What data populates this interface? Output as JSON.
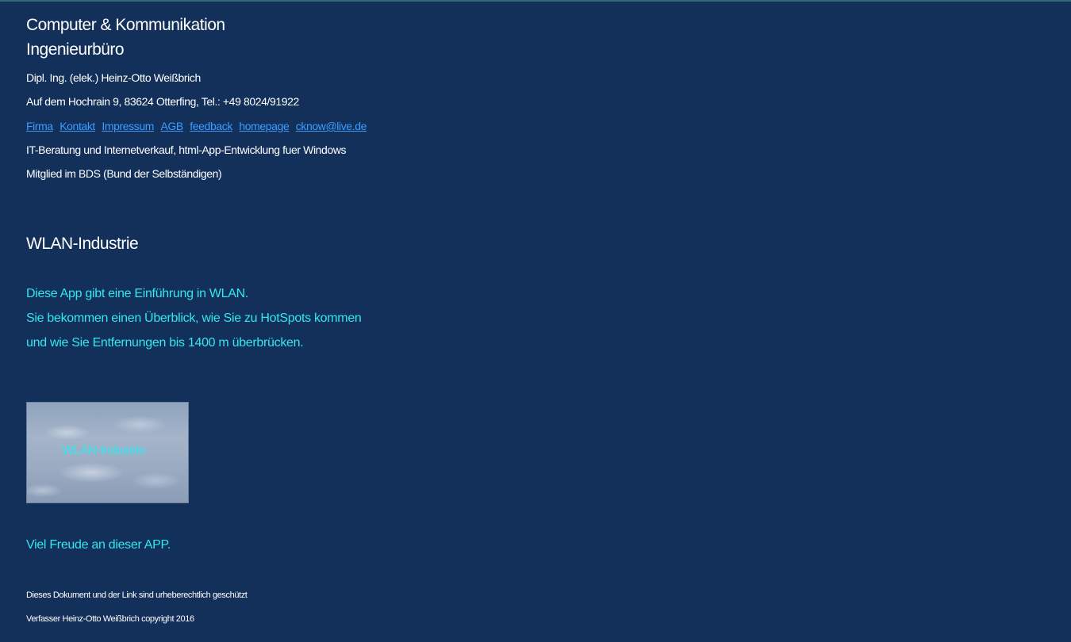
{
  "header": {
    "company_line1": "Computer & Kommunikation",
    "company_line2": "Ingenieurbüro",
    "owner": "Dipl. Ing. (elek.) Heinz-Otto Weißbrich",
    "address": "Auf dem Hochrain 9, 83624 Otterfing,   Tel.: +49 8024/91922",
    "nav_links": [
      {
        "label": "Firma"
      },
      {
        "label": "Kontakt"
      },
      {
        "label": "Impressum"
      },
      {
        "label": "AGB"
      },
      {
        "label": "feedback"
      },
      {
        "label": "homepage"
      },
      {
        "label": "cknow@live.de"
      }
    ],
    "services": "IT-Beratung und Internetverkauf, html-App-Entwicklung fuer Windows",
    "membership": "Mitglied im BDS (Bund der Selbständigen)"
  },
  "main": {
    "heading": "WLAN-Industrie",
    "intro_lines": [
      "Diese App gibt eine Einführung in WLAN.",
      "Sie bekommen einen Überblick, wie Sie zu HotSpots kommen",
      "und wie Sie Entfernungen bis 1400 m überbrücken."
    ],
    "thumbnail_label": "WLAN-Industrie",
    "closing": "Viel Freude an dieser  APP."
  },
  "footer": {
    "copyright_note": "Dieses Dokument und der Link  sind urheberechtlich geschützt",
    "author": "Verfasser Heinz-Otto Weißbrich copyright 2016"
  },
  "colors": {
    "background": "#12305a",
    "link": "#3d9cff",
    "accent_text": "#33e6f0"
  }
}
